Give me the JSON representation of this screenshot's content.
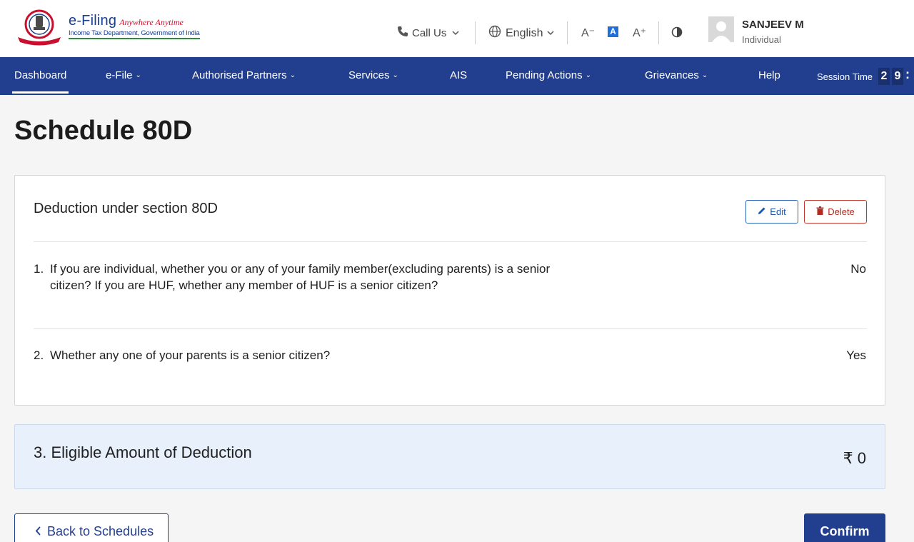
{
  "header": {
    "brand_main": "e-Filing",
    "brand_tagline": "Anywhere Anytime",
    "brand_sub": "Income Tax Department, Government of India",
    "call_label": "Call Us",
    "language": "English",
    "font_decrease": "A⁻",
    "font_normal": "A",
    "font_increase": "A⁺",
    "contrast_icon": "contrast-icon",
    "user_name": "SANJEEV M",
    "user_role": "Individual"
  },
  "nav": {
    "items": [
      {
        "label": "Dashboard",
        "dropdown": false
      },
      {
        "label": "e-File",
        "dropdown": true
      },
      {
        "label": "Authorised Partners",
        "dropdown": true
      },
      {
        "label": "Services",
        "dropdown": true
      },
      {
        "label": "AIS",
        "dropdown": false
      },
      {
        "label": "Pending Actions",
        "dropdown": true
      },
      {
        "label": "Grievances",
        "dropdown": true
      },
      {
        "label": "Help",
        "dropdown": false
      }
    ],
    "session_label": "Session Time",
    "session_digits": [
      "2",
      "9"
    ]
  },
  "page": {
    "title": "Schedule 80D"
  },
  "card": {
    "title": "Deduction under section 80D",
    "edit_label": "Edit",
    "delete_label": "Delete",
    "questions": [
      {
        "num": "1.",
        "text": "If you are individual, whether you or any of your family member(excluding parents) is a senior citizen? If you are HUF, whether any member of HUF is a senior citizen?",
        "answer": "No"
      },
      {
        "num": "2.",
        "text": "Whether any one of your parents is a senior citizen?",
        "answer": "Yes"
      }
    ]
  },
  "summary": {
    "label": "3. Eligible Amount of Deduction",
    "value": "₹ 0"
  },
  "footer": {
    "back_label": "Back to Schedules",
    "confirm_label": "Confirm"
  },
  "colors": {
    "nav_bg": "#223e8f",
    "summary_bg": "#e8f1fb",
    "delete_red": "#c0392b",
    "edit_blue": "#2c65b5"
  }
}
